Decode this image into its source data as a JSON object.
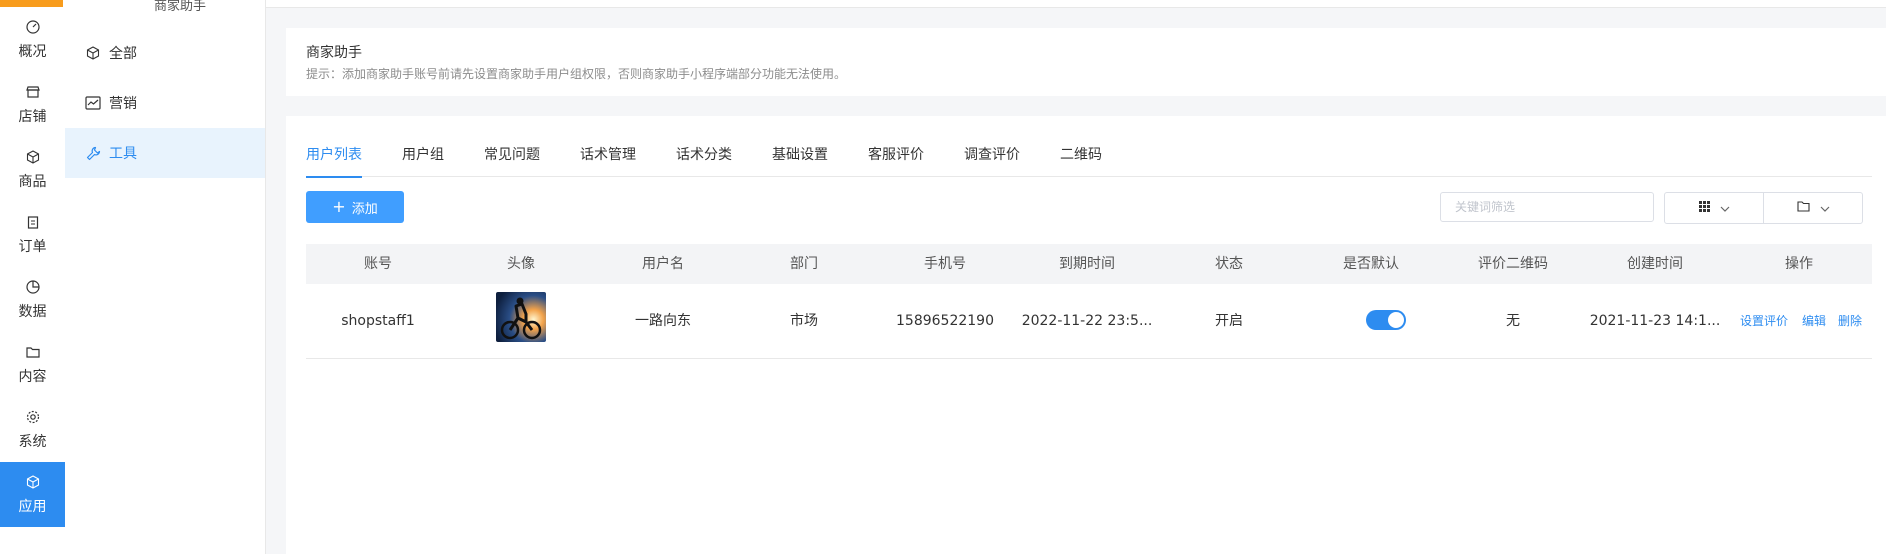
{
  "sidebar": {
    "items": [
      {
        "label": "概况",
        "icon": "dashboard-icon"
      },
      {
        "label": "店铺",
        "icon": "shop-icon"
      },
      {
        "label": "商品",
        "icon": "cube-icon"
      },
      {
        "label": "订单",
        "icon": "clipboard-icon"
      },
      {
        "label": "数据",
        "icon": "pie-icon"
      },
      {
        "label": "内容",
        "icon": "folder-icon"
      },
      {
        "label": "系统",
        "icon": "gear-icon"
      },
      {
        "label": "应用",
        "icon": "cube-icon"
      }
    ],
    "active_index": 7,
    "accent_color": "#2d8cf0",
    "top_accent_color": "#f89c1c"
  },
  "subnav": {
    "title": "商家助手",
    "items": [
      {
        "label": "全部",
        "icon": "cube-icon"
      },
      {
        "label": "营销",
        "icon": "chart-line-icon"
      },
      {
        "label": "工具",
        "icon": "wrench-icon"
      }
    ],
    "active_index": 2
  },
  "notice": {
    "title": "商家助手",
    "desc": "提示：添加商家助手账号前请先设置商家助手用户组权限，否则商家助手小程序端部分功能无法使用。"
  },
  "tabs": [
    "用户列表",
    "用户组",
    "常见问题",
    "话术管理",
    "话术分类",
    "基础设置",
    "客服评价",
    "调查评价",
    "二维码"
  ],
  "active_tab": 0,
  "toolbar": {
    "add_label": "添加",
    "search_placeholder": "关键词筛选"
  },
  "table": {
    "headers": [
      "账号",
      "头像",
      "用户名",
      "部门",
      "手机号",
      "到期时间",
      "状态",
      "是否默认",
      "评价二维码",
      "创建时间",
      "操作"
    ],
    "rows": [
      {
        "account": "shopstaff1",
        "username": "一路向东",
        "department": "市场",
        "phone": "15896522190",
        "expire": "2022-11-22 23:5...",
        "status": "开启",
        "is_default": true,
        "qrcode": "无",
        "created": "2021-11-23 14:1...",
        "actions": [
          "设置评价",
          "编辑",
          "删除"
        ]
      }
    ]
  }
}
